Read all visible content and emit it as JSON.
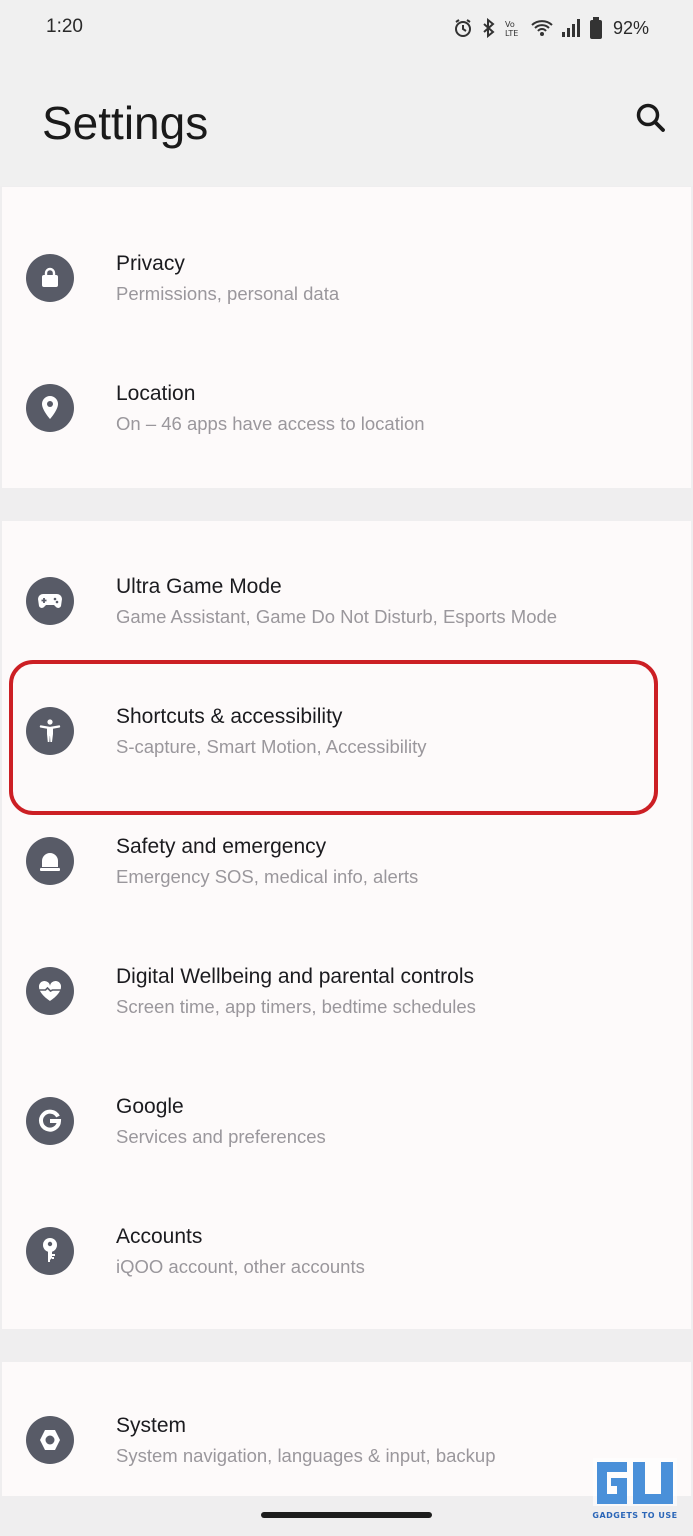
{
  "status_bar": {
    "time": "1:20",
    "battery": "92%",
    "icons": [
      "alarm-icon",
      "bluetooth-icon",
      "volte-icon",
      "wifi-icon",
      "signal-icon",
      "battery-icon"
    ]
  },
  "header": {
    "title": "Settings",
    "search_icon": "search-icon"
  },
  "groups": [
    {
      "items": [
        {
          "label": "Privacy",
          "subtitle": "Permissions, personal data",
          "icon": "lock-icon"
        },
        {
          "label": "Location",
          "subtitle": "On – 46 apps have access to location",
          "icon": "location-pin-icon"
        }
      ]
    },
    {
      "items": [
        {
          "label": "Ultra Game Mode",
          "subtitle": "Game Assistant, Game Do Not Disturb, Esports Mode",
          "icon": "gamepad-icon"
        },
        {
          "label": "Shortcuts & accessibility",
          "subtitle": "S-capture, Smart Motion, Accessibility",
          "icon": "accessibility-icon"
        },
        {
          "label": "Safety and emergency",
          "subtitle": "Emergency SOS, medical info, alerts",
          "icon": "emergency-light-icon"
        },
        {
          "label": "Digital Wellbeing and parental controls",
          "subtitle": "Screen time, app timers, bedtime schedules",
          "icon": "heart-icon"
        },
        {
          "label": "Google",
          "subtitle": "Services and preferences",
          "icon": "google-icon"
        },
        {
          "label": "Accounts",
          "subtitle": "iQOO account, other accounts",
          "icon": "key-icon"
        }
      ]
    },
    {
      "items": [
        {
          "label": "System",
          "subtitle": "System navigation, languages & input, backup",
          "icon": "system-hexagon-icon"
        }
      ]
    }
  ],
  "watermark": {
    "logo_text": "GU",
    "caption": "GADGETS TO USE"
  },
  "colors": {
    "icon_bg": "#585b67",
    "highlight": "#cc1f24",
    "card_bg": "#fdfafa",
    "page_bg": "#efeeef"
  }
}
